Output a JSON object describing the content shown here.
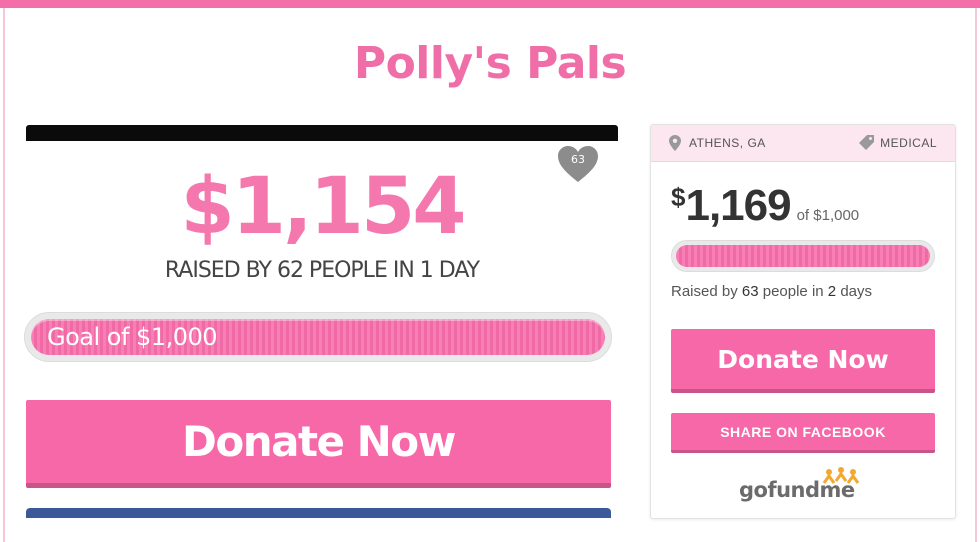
{
  "page": {
    "title": "Polly's Pals"
  },
  "video_panel": {
    "heart_count": "63",
    "amount": "$1,154",
    "raised_text": "RAISED BY 62 PEOPLE IN 1 DAY",
    "goal_label": "Goal of $1,000",
    "goal_progress": 1.0,
    "donate_label": "Donate Now"
  },
  "card": {
    "location": "ATHENS, GA",
    "category": "MEDICAL",
    "amount_symbol": "$",
    "amount": "1,169",
    "goal_text": "of $1,000",
    "progress": 1.0,
    "raised_prefix": "Raised by",
    "people_count": "63",
    "raised_mid": "people in",
    "days_count": "2",
    "raised_suffix": "days",
    "donate_label": "Donate Now",
    "share_label": "SHARE ON FACEBOOK",
    "logo_text": "gofundme"
  },
  "colors": {
    "accent": "#f768a9",
    "title": "#f06ea8",
    "facebook": "#3b5998"
  }
}
